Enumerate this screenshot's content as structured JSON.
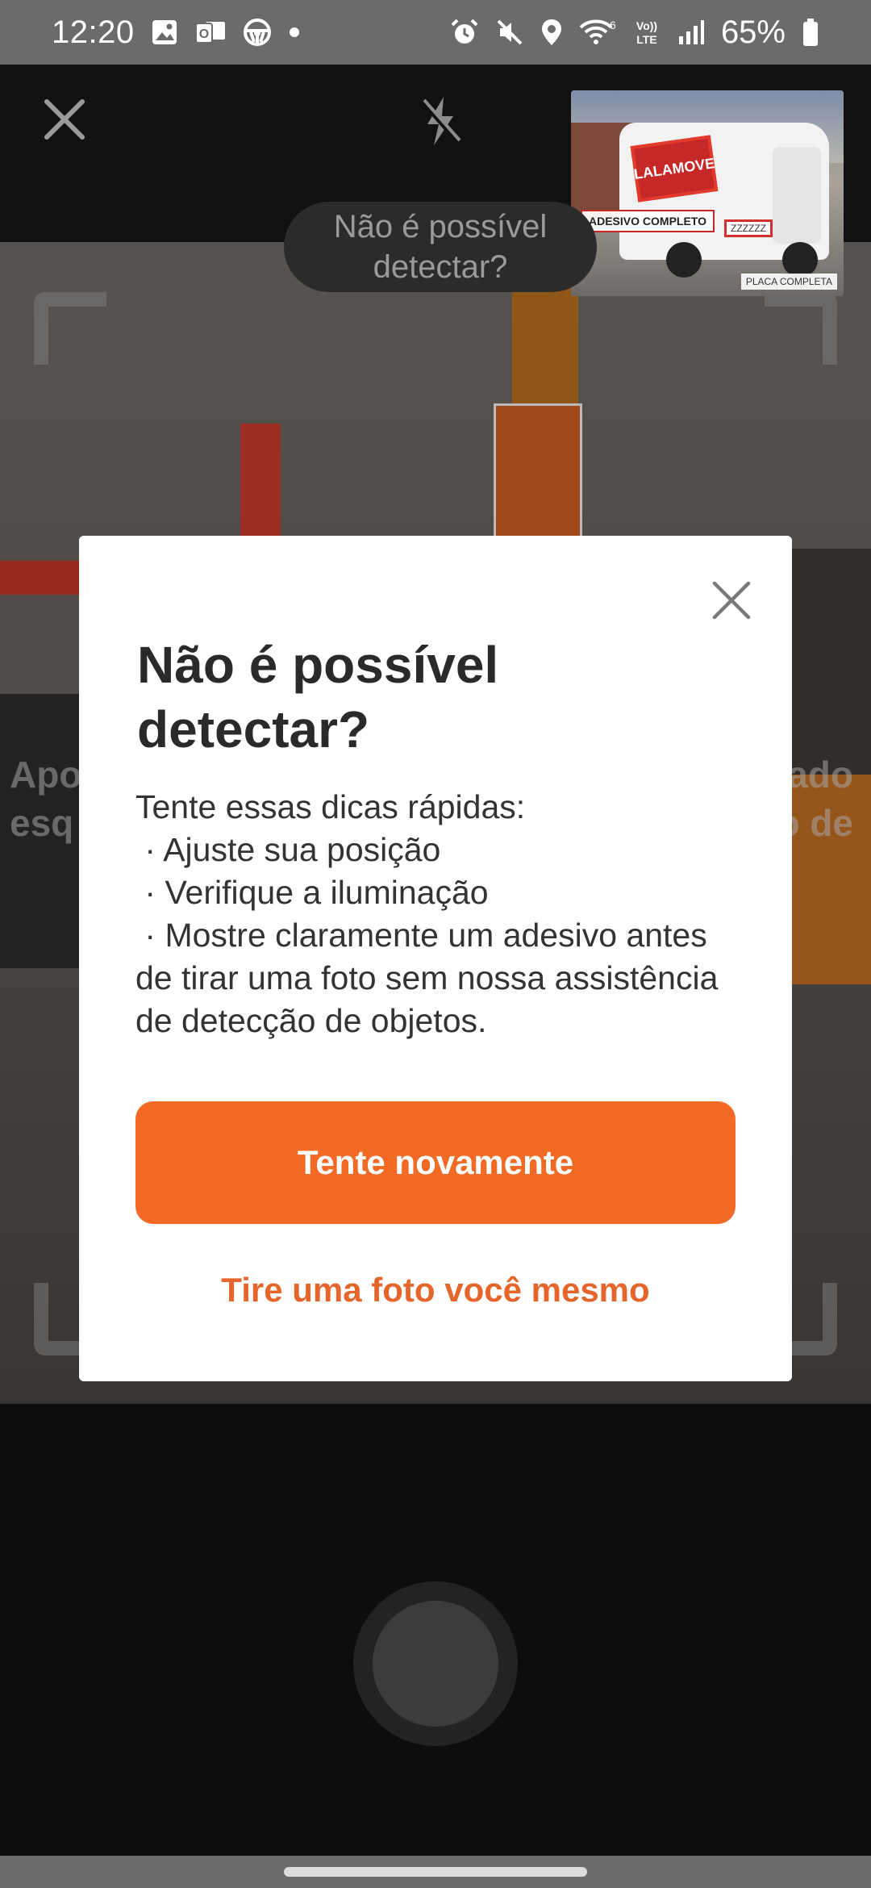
{
  "status_bar": {
    "time": "12:20",
    "battery": "65%",
    "left_icons": [
      "gallery-icon",
      "outlook-icon",
      "steering-wheel-icon",
      "dot-icon"
    ],
    "right_icons": [
      "alarm-icon",
      "mute-icon",
      "location-icon",
      "wifi-6-icon",
      "volte-icon",
      "signal-icon",
      "battery-icon"
    ],
    "volte_label": "Vo)) LTE"
  },
  "camera": {
    "detect_prompt": "Não é possível detectar?",
    "reference": {
      "logo_text": "LALAMOVE",
      "sticker_label": "ADESIVO COMPLETO",
      "plate_text": "ZZZZZZ",
      "plate_label": "PLACA COMPLETA"
    },
    "preview_hint_left": "Apo\nesq",
    "preview_hint_right": "ado\no de"
  },
  "modal": {
    "title": "Não é possível detectar?",
    "intro": "Tente essas dicas rápidas:",
    "tips": [
      " · Ajuste sua posição",
      " · Verifique a iluminação",
      " · Mostre claramente um adesivo antes de tirar uma foto sem nossa assistência de detecção de objetos."
    ],
    "primary_button": "Tente novamente",
    "secondary_button": "Tire uma foto você mesmo"
  },
  "colors": {
    "accent": "#f26a24",
    "accent_text": "#e5652a",
    "status_bar": "#6b6b6b"
  }
}
